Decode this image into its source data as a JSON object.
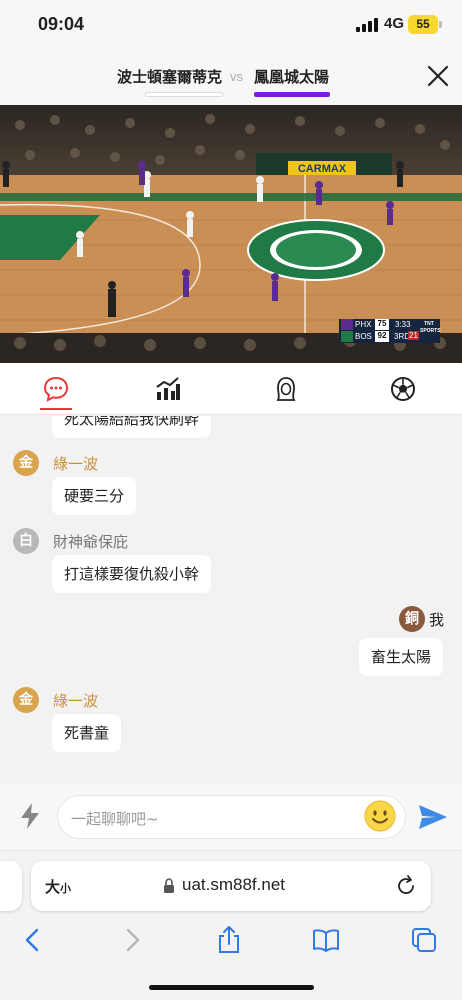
{
  "status_bar": {
    "time": "09:04",
    "network": "4G",
    "battery": "55"
  },
  "match": {
    "home_team": "波士頓塞爾蒂克",
    "vs": "vs",
    "away_team": "鳳凰城太陽",
    "accent_color": "#7a1fd6"
  },
  "video": {
    "arena_sign": "CARMAX",
    "scoreboard": {
      "team1": "PHX",
      "score1": "75",
      "team2": "BOS",
      "score2": "92",
      "clock": "3:33",
      "period": "3RD",
      "shot_clock": "21",
      "network": "TNT SPORTS"
    }
  },
  "tabs": [
    {
      "icon": "chat-icon",
      "active": true
    },
    {
      "icon": "stats-icon",
      "active": false
    },
    {
      "icon": "player-icon",
      "active": false
    },
    {
      "icon": "soccer-ball-icon",
      "active": false
    }
  ],
  "chat": {
    "partial_message": "死太陽給給我快刷幹",
    "messages": [
      {
        "badge": "金",
        "user": "綠一波",
        "text": "硬要三分"
      },
      {
        "badge": "白",
        "user": "財神爺保庇",
        "text": "打這樣要復仇殺小幹"
      },
      {
        "badge": "銅",
        "user": "我",
        "text": "畜生太陽",
        "self": true
      },
      {
        "badge": "金",
        "user": "綠一波",
        "text": "死書童"
      }
    ]
  },
  "composer": {
    "placeholder": "一起聊聊吧~"
  },
  "browser": {
    "text_size_label": "大",
    "text_size_small": "小",
    "url": "uat.sm88f.net"
  }
}
